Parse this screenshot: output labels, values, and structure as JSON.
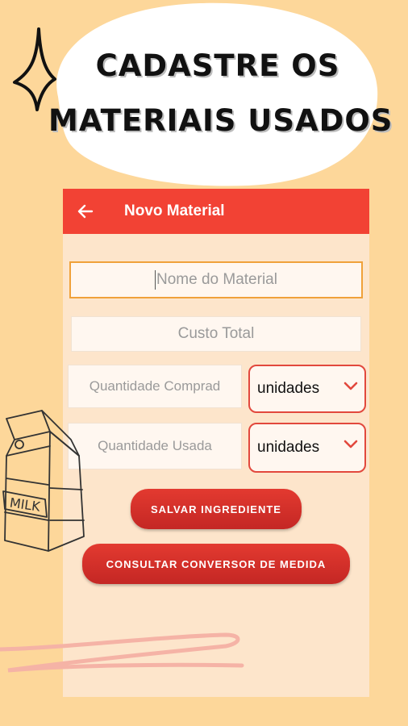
{
  "headline": {
    "line1": "CADASTRE OS",
    "line2": "MATERIAIS USADOS"
  },
  "appbar": {
    "back_icon": "arrow-left-icon",
    "title": "Novo Material"
  },
  "form": {
    "nome_placeholder": "Nome do Material",
    "custo_placeholder": "Custo Total",
    "qtd_comprada_placeholder": "Quantidade Comprad",
    "qtd_comprada_unit": "unidades",
    "qtd_usada_placeholder": "Quantidade Usada",
    "qtd_usada_unit": "unidades"
  },
  "buttons": {
    "salvar_label": "SALVAR INGREDIENTE",
    "consultar_label": "CONSULTAR CONVERSOR DE MEDIDA"
  },
  "decor": {
    "milk_carton_text": "MILK"
  },
  "colors": {
    "background": "#fdd79a",
    "appbar": "#f24234",
    "accent": "#e2483d",
    "focus": "#f0a13a"
  }
}
